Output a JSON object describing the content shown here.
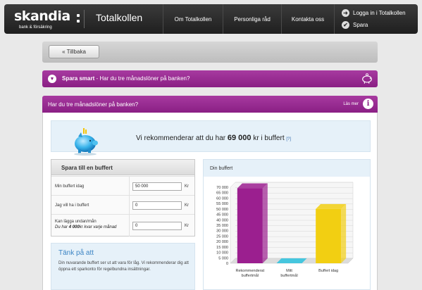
{
  "header": {
    "logo": "skandia",
    "logo_sub": "bank & försäkring",
    "title": "Totalkollen",
    "nav": [
      "Om Totalkollen",
      "Personliga råd",
      "Kontakta oss"
    ],
    "login_label": "Logga in i Totalkollen",
    "save_label": "Spara"
  },
  "back_label": "« Tillbaka",
  "section": {
    "title": "Spara smart",
    "question": " - Har du tre månadslöner på banken?"
  },
  "subsection": {
    "title": "Har du tre månadslöner på banken?",
    "read_more": "Läs mer",
    "info_icon": "i"
  },
  "recommendation": {
    "prefix": "Vi rekommenderar att du har ",
    "amount": "69 000",
    "suffix": " kr i buffert",
    "help": "[?]"
  },
  "buffer_form": {
    "title": "Spara till en buffert",
    "rows": [
      {
        "label": "Min buffert idag",
        "value": "50 000",
        "unit": "Kr"
      },
      {
        "label": "Jag vill ha i buffert",
        "value": "0",
        "unit": "Kr"
      },
      {
        "label": "Kan lägga undan/mån",
        "hint_prefix": "Du har ",
        "hint_amount": "4 000",
        "hint_suffix": "kr kvar varje månad",
        "value": "0",
        "unit": "Kr"
      }
    ]
  },
  "tip": {
    "title": "Tänk på att",
    "body": "Din nuvarande buffert ser ut att vara för låg. Vi rekommenderar dig att öppna ett sparkonto för regelbundna insättningar."
  },
  "chart_panel": {
    "title": "Din buffert"
  },
  "chart_data": {
    "type": "bar",
    "categories": [
      "Rekommenderat buffertmål",
      "Mitt buffertmål",
      "Buffert idag"
    ],
    "values": [
      69000,
      0,
      50000
    ],
    "colors": [
      "#9b1f8f",
      "#2cc2de",
      "#f2cf12"
    ],
    "yticks": [
      "70 000",
      "65 000",
      "60 000",
      "55 000",
      "50 000",
      "45 000",
      "40 000",
      "35 000",
      "30 000",
      "25 000",
      "20 000",
      "15 000",
      "10 000",
      "5 000",
      "0"
    ],
    "ylim": [
      0,
      70000
    ],
    "grid": true
  }
}
